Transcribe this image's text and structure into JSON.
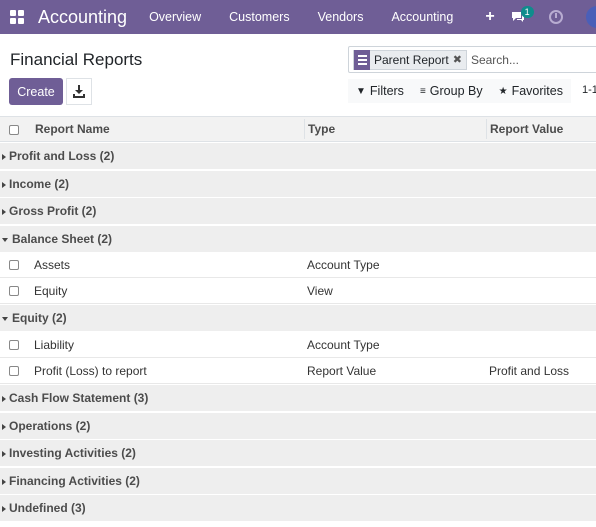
{
  "navbar": {
    "brand": "Accounting",
    "items": [
      "Overview",
      "Customers",
      "Vendors",
      "Accounting"
    ],
    "plus": "+",
    "chat_count": "1"
  },
  "control": {
    "title": "Financial Reports",
    "facet_label": "Parent Report",
    "facet_close": "✖",
    "search_placeholder": "Search...",
    "create_label": "Create",
    "filters_label": "Filters",
    "groupby_label": "Group By",
    "favorites_label": "Favorites",
    "pager": "1-1"
  },
  "table": {
    "headers": [
      "Report Name",
      "Type",
      "Report Value"
    ],
    "groups": [
      {
        "label": "Profit and Loss (2)",
        "open": false,
        "rows": []
      },
      {
        "label": "Income (2)",
        "open": false,
        "rows": []
      },
      {
        "label": "Gross Profit (2)",
        "open": false,
        "rows": []
      },
      {
        "label": "Balance Sheet (2)",
        "open": true,
        "rows": [
          {
            "name": "Assets",
            "type": "Account Type",
            "value": ""
          },
          {
            "name": "Equity",
            "type": "View",
            "value": ""
          }
        ]
      },
      {
        "label": "Equity (2)",
        "open": true,
        "rows": [
          {
            "name": "Liability",
            "type": "Account Type",
            "value": ""
          },
          {
            "name": "Profit (Loss) to report",
            "type": "Report Value",
            "value": "Profit and Loss"
          }
        ]
      },
      {
        "label": "Cash Flow Statement (3)",
        "open": false,
        "rows": []
      },
      {
        "label": "Operations (2)",
        "open": false,
        "rows": []
      },
      {
        "label": "Investing Activities (2)",
        "open": false,
        "rows": []
      },
      {
        "label": "Financing Activities (2)",
        "open": false,
        "rows": []
      },
      {
        "label": "Undefined (3)",
        "open": false,
        "rows": []
      }
    ]
  },
  "colors": {
    "brand": "#6f5e96",
    "badge": "#0f8c8c"
  }
}
